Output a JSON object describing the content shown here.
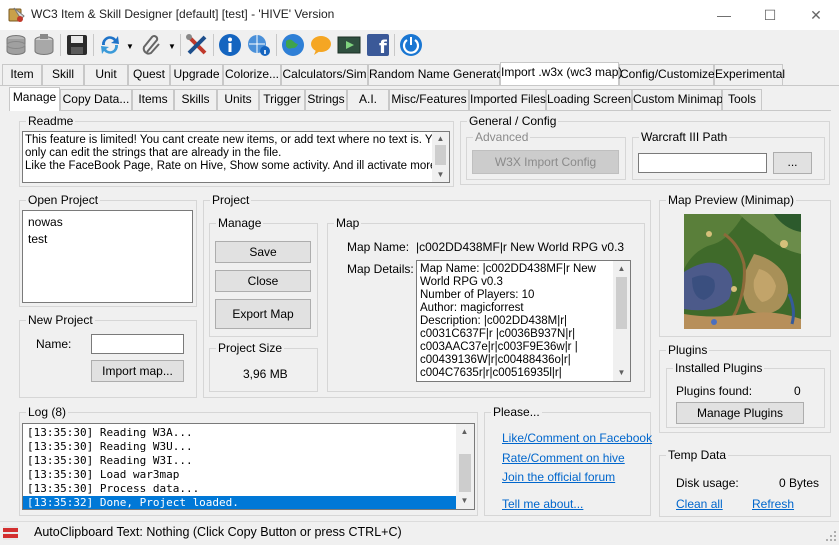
{
  "window": {
    "title": "WC3 Item & Skill Designer [default] [test] - 'HIVE' Version",
    "minimize": "—",
    "maximize": "☐",
    "close": "✕"
  },
  "toolbar": {
    "icons": [
      "database-icon",
      "database-alt-icon",
      "save-icon",
      "refresh-icon",
      "paperclip-icon",
      "tools-icon",
      "info-icon",
      "web-info-icon",
      "globe-icon",
      "chat-icon",
      "video-icon",
      "facebook-icon",
      "power-icon"
    ],
    "facebook_glyph": "f"
  },
  "main_tabs": [
    "Item",
    "Skill",
    "Unit",
    "Quest",
    "Upgrade",
    "Colorize...",
    "Calculators/Sim",
    "Random Name Generator",
    "Import .w3x (wc3 map)",
    "Config/Customize",
    "Experimental"
  ],
  "sub_tabs": [
    "Manage",
    "Copy Data...",
    "Items",
    "Skills",
    "Units",
    "Trigger",
    "Strings",
    "A.I.",
    "Misc/Features",
    "Imported Files",
    "Loading Screen",
    "Custom Minimap",
    "Tools"
  ],
  "readme": {
    "label": "Readme",
    "text_line1": "This feature is limited! You cant create new items, or add text where no text is. You",
    "text_line2": "only can edit the strings that are already in the file.",
    "text_line3": "Like the FaceBook Page, Rate on Hive, Show some activity. And ill activate more"
  },
  "general_config": {
    "label": "General / Config",
    "advanced_label": "Advanced",
    "w3x_button": "W3X Import Config",
    "wc3_path_label": "Warcraft III Path",
    "wc3_path_value": "",
    "browse_button": "..."
  },
  "open_project": {
    "label": "Open Project",
    "items": [
      "nowas",
      "test"
    ]
  },
  "new_project": {
    "label": "New Project",
    "name_label": "Name:",
    "name_value": "",
    "import_button": "Import map..."
  },
  "project": {
    "label": "Project",
    "manage_label": "Manage",
    "save_button": "Save",
    "close_button": "Close",
    "export_button": "Export Map",
    "size_label": "Project Size",
    "size_value": "3,96 MB"
  },
  "map": {
    "label": "Map",
    "name_label": "Map Name:",
    "name_value": "|c002DD438MF|r New World RPG v0.3",
    "details_label": "Map Details:",
    "details_lines": [
      "Map Name: |c002DD438MF|r New",
      "World RPG v0.3",
      "Number of Players: 10",
      "Author: magicforrest",
      "Description: |c002DD438M|r|",
      "c0031C637F|r |c0036B937N|r|",
      "c003AAC37e|r|c003F9E36w|r |",
      "c00439136W|r|c00488436o|r|",
      "c004C7635r|r|c00516935l|r|"
    ]
  },
  "map_preview": {
    "label": "Map Preview (Minimap)"
  },
  "plugins": {
    "label": "Plugins",
    "installed_label": "Installed Plugins",
    "found_label": "Plugins found:",
    "found_value": "0",
    "manage_button": "Manage Plugins"
  },
  "temp_data": {
    "label": "Temp Data",
    "disk_label": "Disk usage:",
    "disk_value": "0 Bytes",
    "clean_link": "Clean all",
    "refresh_link": "Refresh"
  },
  "log": {
    "label": "Log (8)",
    "lines": [
      "[13:35:30] Reading W3A...",
      "[13:35:30] Reading W3U...",
      "[13:35:30] Reading W3I...",
      "[13:35:30] Load war3map",
      "[13:35:30] Process data...",
      "[13:35:32] Done, Project loaded."
    ]
  },
  "please": {
    "label": "Please...",
    "link_facebook": "Like/Comment on Facebook",
    "link_hive": "Rate/Comment on hive",
    "link_forum": "Join the official forum",
    "link_tell": "Tell me about..."
  },
  "status": {
    "text": "AutoClipboard Text: Nothing (Click Copy Button or press CTRL+C)"
  }
}
